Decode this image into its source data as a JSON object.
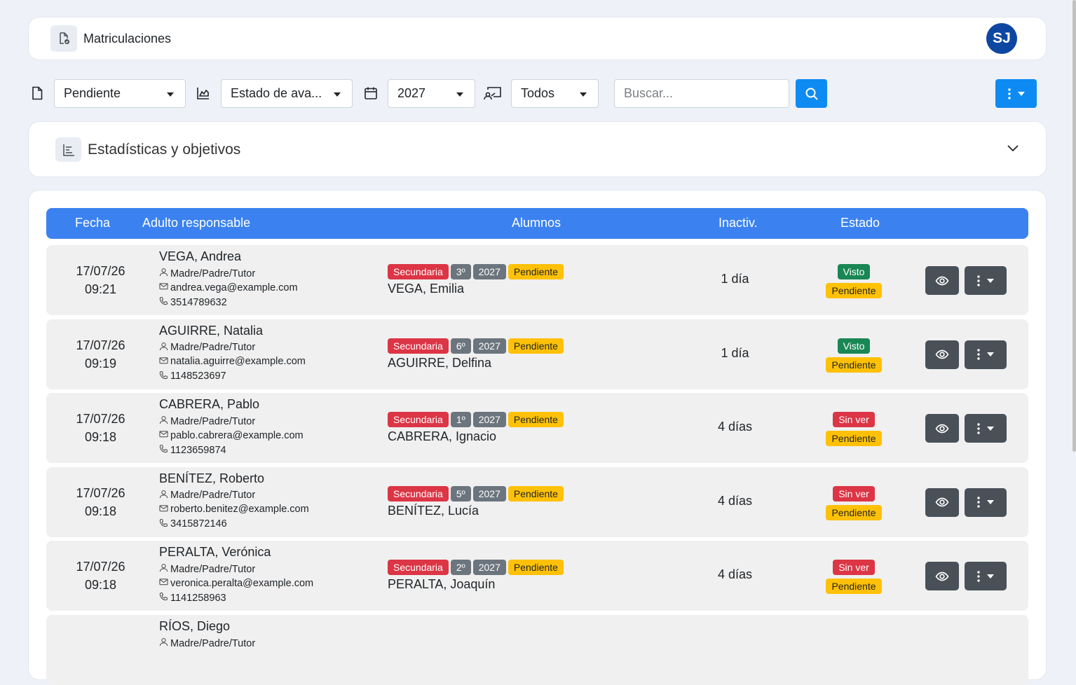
{
  "header": {
    "title": "Matriculaciones",
    "avatar_initials": "SJ"
  },
  "filters": {
    "status": "Pendiente",
    "progress": "Estado de ava...",
    "year": "2027",
    "channel": "Todos",
    "search_placeholder": "Buscar..."
  },
  "stats": {
    "title": "Estadísticas y objetivos"
  },
  "table": {
    "columns": [
      "Fecha",
      "Adulto responsable",
      "Alumnos",
      "Inactiv.",
      "Estado"
    ],
    "rows": [
      {
        "date": "17/07/26",
        "time": "09:21",
        "name": "VEGA, Andrea",
        "role": "Madre/Padre/Tutor",
        "email": "andrea.vega@example.com",
        "phone": "3514789632",
        "level": "Secundaria",
        "grade": "3º",
        "year": "2027",
        "student_status": "Pendiente",
        "student": "VEGA, Emilia",
        "inactivity": "1 día",
        "view_status": "Visto",
        "status": "Pendiente"
      },
      {
        "date": "17/07/26",
        "time": "09:19",
        "name": "AGUIRRE, Natalia",
        "role": "Madre/Padre/Tutor",
        "email": "natalia.aguirre@example.com",
        "phone": "1148523697",
        "level": "Secundaria",
        "grade": "6º",
        "year": "2027",
        "student_status": "Pendiente",
        "student": "AGUIRRE, Delfina",
        "inactivity": "1 día",
        "view_status": "Visto",
        "status": "Pendiente"
      },
      {
        "date": "17/07/26",
        "time": "09:18",
        "name": "CABRERA, Pablo",
        "role": "Madre/Padre/Tutor",
        "email": "pablo.cabrera@example.com",
        "phone": "1123659874",
        "level": "Secundaria",
        "grade": "1º",
        "year": "2027",
        "student_status": "Pendiente",
        "student": "CABRERA, Ignacio",
        "inactivity": "4 días",
        "view_status": "Sin ver",
        "status": "Pendiente"
      },
      {
        "date": "17/07/26",
        "time": "09:18",
        "name": "BENÍTEZ, Roberto",
        "role": "Madre/Padre/Tutor",
        "email": "roberto.benitez@example.com",
        "phone": "3415872146",
        "level": "Secundaria",
        "grade": "5º",
        "year": "2027",
        "student_status": "Pendiente",
        "student": "BENÍTEZ, Lucía",
        "inactivity": "4 días",
        "view_status": "Sin ver",
        "status": "Pendiente"
      },
      {
        "date": "17/07/26",
        "time": "09:18",
        "name": "PERALTA, Verónica",
        "role": "Madre/Padre/Tutor",
        "email": "veronica.peralta@example.com",
        "phone": "1141258963",
        "level": "Secundaria",
        "grade": "2º",
        "year": "2027",
        "student_status": "Pendiente",
        "student": "PERALTA, Joaquín",
        "inactivity": "4 días",
        "view_status": "Sin ver",
        "status": "Pendiente"
      },
      {
        "name": "RÍOS, Diego",
        "role": "Madre/Padre/Tutor"
      }
    ]
  },
  "colors": {
    "primary": "#0d8bf2",
    "header": "#3b82f0",
    "danger": "#dc3545",
    "warning": "#ffc107",
    "success": "#198754",
    "secondary": "#6c757d"
  }
}
